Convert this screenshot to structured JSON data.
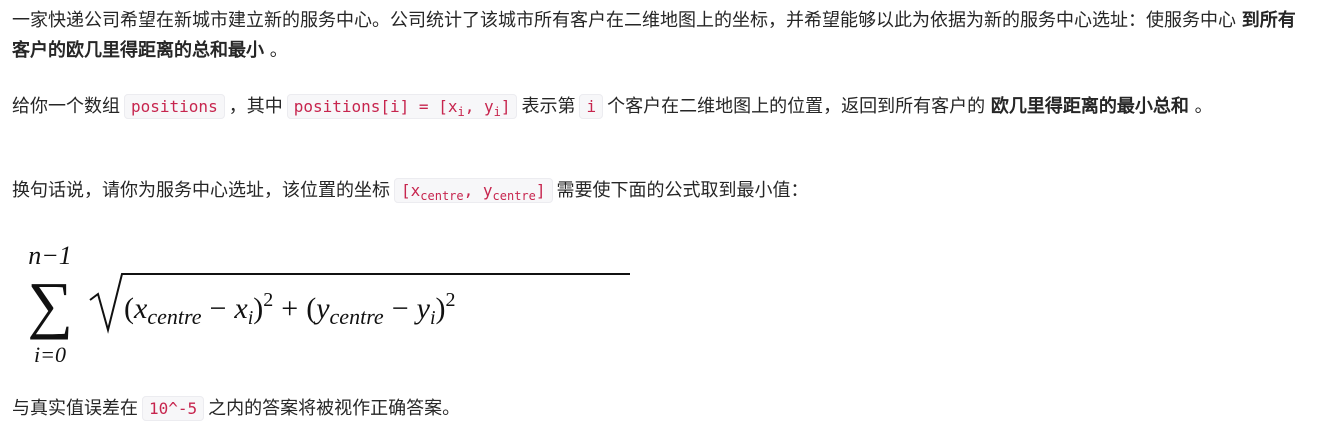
{
  "paragraph1": {
    "text": "一家快递公司希望在新城市建立新的服务中心。公司统计了该城市所有客户在二维地图上的坐标，并希望能够以此为依据为新的服务中心选址：使服务中心 ",
    "bold": "到所有客户的欧几里得距离的总和最小",
    "tail": " 。"
  },
  "paragraph2": {
    "lead": "给你一个数组",
    "code_positions": "positions",
    "mid": "，其中",
    "code_def_prefix": "positions[i] = [x",
    "code_def_sub1": "i",
    "code_def_middle": ", y",
    "code_def_sub2": "i",
    "code_def_suffix": "]",
    "mid2": "表示第",
    "code_i": "i",
    "mid3": "个客户在二维地图上的位置，返回到所有客户的 ",
    "bold": "欧几里得距离的最小总和",
    "tail": " 。"
  },
  "paragraph3": {
    "lead": "换句话说，请你为服务中心选址，该位置的坐标",
    "code_prefix": "[x",
    "code_sub1": "centre",
    "code_middle": ", y",
    "code_sub2": "centre",
    "code_suffix": "]",
    "tail": "需要使下面的公式取到最小值："
  },
  "formula": {
    "upper_limit": "n−1",
    "lower_limit": "i=0",
    "sum_symbol": "∑",
    "x_centre_base": "x",
    "x_centre_sub": "centre",
    "minus": "−",
    "x_i_base": "x",
    "x_i_sub": "i",
    "plus": "+",
    "y_centre_base": "y",
    "y_centre_sub": "centre",
    "y_i_base": "y",
    "y_i_sub": "i",
    "exponent": "2",
    "open_paren": "(",
    "close_paren": ")"
  },
  "paragraph4": {
    "lead": "与真实值误差在",
    "code": "10^-5",
    "tail": "之内的答案将被视作正确答案。"
  }
}
